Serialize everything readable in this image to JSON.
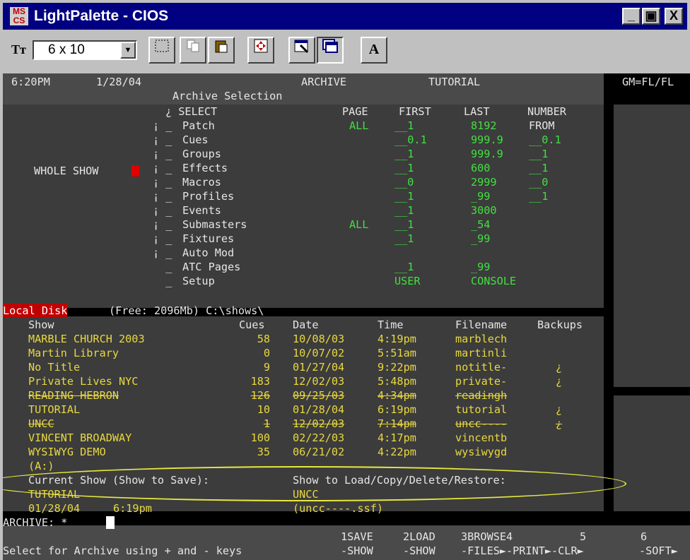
{
  "window": {
    "icon_text": "MS CS",
    "title": "LightPalette - CIOS",
    "controls": [
      "_",
      "▣",
      "X"
    ]
  },
  "toolbar": {
    "font_icon": "Tт",
    "font_size": "6 x 10",
    "buttons": [
      "select-icon",
      "copy-icon",
      "paste-icon",
      "fullscreen-icon",
      "properties-icon",
      "window-icon",
      "font-icon"
    ],
    "font_button_label": "A"
  },
  "header": {
    "time": "6:20PM",
    "date": "1/28/04",
    "mode": "ARCHIVE",
    "screen": "Archive Selection",
    "show": "TUTORIAL",
    "gm": "GM=FL/FL"
  },
  "archive": {
    "whole_show_label": "WHOLE SHOW",
    "columns": {
      "select": "¿ SELECT",
      "page": "PAGE",
      "first": "FIRST",
      "last": "LAST",
      "number_from": "NUMBER",
      "from": "FROM"
    },
    "rows": [
      {
        "name": "Patch",
        "page": "ALL",
        "first": "__1",
        "last": "8192",
        "number": "FROM"
      },
      {
        "name": "Cues",
        "page": "",
        "first": "__0.1",
        "last": "999.9",
        "number": "__0.1"
      },
      {
        "name": "Groups",
        "page": "",
        "first": "__1",
        "last": "999.9",
        "number": "__1"
      },
      {
        "name": "Effects",
        "page": "",
        "first": "__1",
        "last": "600",
        "number": "__1"
      },
      {
        "name": "Macros",
        "page": "",
        "first": "__0",
        "last": "2999",
        "number": "__0"
      },
      {
        "name": "Profiles",
        "page": "",
        "first": "__1",
        "last": "_99",
        "number": "__1"
      },
      {
        "name": "Events",
        "page": "",
        "first": "__1",
        "last": "3000",
        "number": ""
      },
      {
        "name": "Submasters",
        "page": "ALL",
        "first": "__1",
        "last": "_54",
        "number": ""
      },
      {
        "name": "Fixtures",
        "page": "",
        "first": "__1",
        "last": "_99",
        "number": ""
      },
      {
        "name": "Auto Mod",
        "page": "",
        "first": "",
        "last": "",
        "number": ""
      },
      {
        "name": "ATC Pages",
        "page": "",
        "first": "__1",
        "last": "_99",
        "number": ""
      },
      {
        "name": "Setup",
        "page": "",
        "first": "USER",
        "last": "CONSOLE",
        "number": ""
      }
    ]
  },
  "disk": {
    "label": "Local Disk",
    "free": "(Free: 2096Mb) C:\\shows\\",
    "headers": {
      "show": "Show",
      "cues": "Cues",
      "date": "Date",
      "time": "Time",
      "filename": "Filename",
      "backups": "Backups"
    },
    "shows": [
      {
        "show": "MARBLE CHURCH 2003",
        "cues": "58",
        "date": "10/08/03",
        "time": "4:19pm",
        "filename": "marblech",
        "backups": ""
      },
      {
        "show": "Martin Library",
        "cues": "0",
        "date": "10/07/02",
        "time": "5:51am",
        "filename": "martinli",
        "backups": ""
      },
      {
        "show": "No Title",
        "cues": "9",
        "date": "01/27/04",
        "time": "9:22pm",
        "filename": "notitle-",
        "backups": "¿"
      },
      {
        "show": "Private Lives NYC",
        "cues": "183",
        "date": "12/02/03",
        "time": "5:48pm",
        "filename": "private-",
        "backups": "¿"
      },
      {
        "show": "READING HEBRON",
        "cues": "126",
        "date": "09/25/03",
        "time": "4:34pm",
        "filename": "readingh",
        "backups": ""
      },
      {
        "show": "TUTORIAL",
        "cues": "10",
        "date": "01/28/04",
        "time": "6:19pm",
        "filename": "tutorial",
        "backups": "¿"
      },
      {
        "show": "UNCC",
        "cues": "1",
        "date": "12/02/03",
        "time": "7:14pm",
        "filename": "uncc----",
        "backups": "¿"
      },
      {
        "show": "VINCENT BROADWAY",
        "cues": "100",
        "date": "02/22/03",
        "time": "4:17pm",
        "filename": "vincentb",
        "backups": ""
      },
      {
        "show": "WYSIWYG DEMO",
        "cues": "35",
        "date": "06/21/02",
        "time": "4:22pm",
        "filename": "wysiwygd",
        "backups": ""
      }
    ],
    "drive_a": "(A:)"
  },
  "status": {
    "current_label": "Current Show (Show to Save):",
    "current_show": "TUTORIAL",
    "current_date": "01/28/04",
    "current_time": "6:19pm",
    "load_label": "Show to Load/Copy/Delete/Restore:",
    "load_show": "UNCC",
    "load_file": "(uncc----.ssf)"
  },
  "command": {
    "prompt": "ARCHIVE: *",
    "hint": "Select for Archive using + and - keys"
  },
  "softkeys": [
    {
      "top": "1SAVE",
      "bottom": "-SHOW"
    },
    {
      "top": "2LOAD",
      "bottom": "-SHOW"
    },
    {
      "top": "3BROWSE4",
      "bottom": "-FILES►-PRINT►-CLR►"
    },
    {
      "top": "5",
      "bottom": ""
    },
    {
      "top": "6",
      "bottom": "-SOFT►"
    }
  ],
  "colors": {
    "titlebar": "#000080",
    "highlight_ellipse": "#e8e840",
    "terminal_green": "#40e040",
    "terminal_yellow": "#e8d840"
  }
}
